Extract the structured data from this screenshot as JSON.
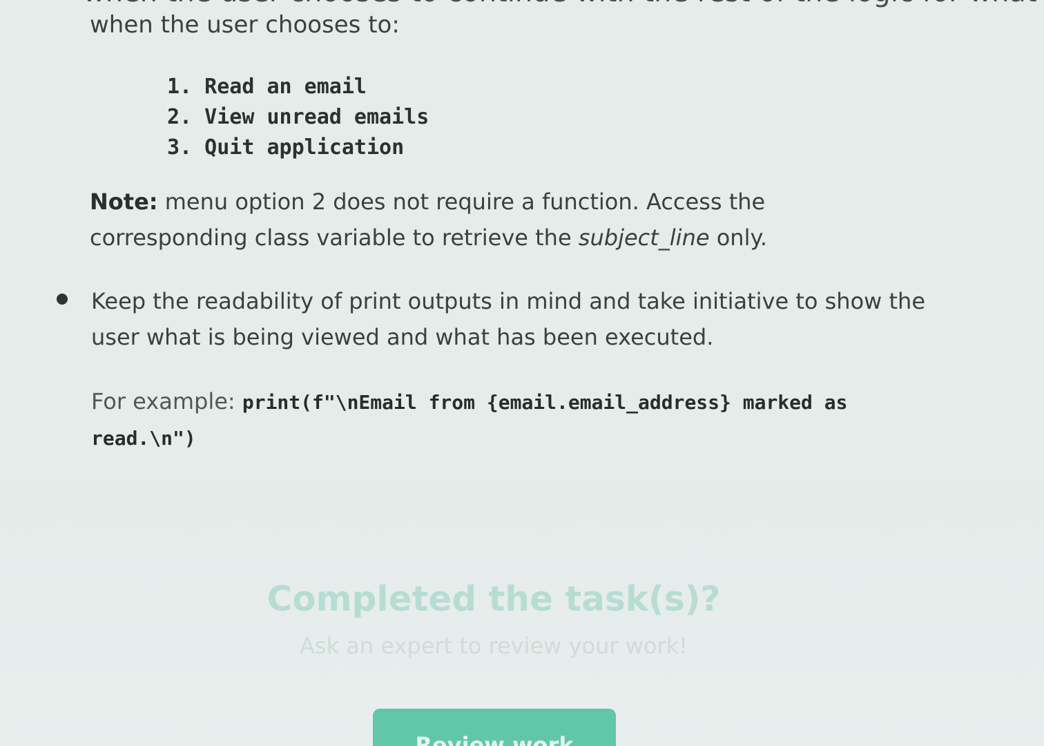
{
  "content": {
    "top_line_partial": "when the user chooses to continue with the rest of the logic for what should happen",
    "intro": "when the user chooses to:",
    "menu_items": [
      "1. Read an email",
      "2. View unread emails",
      "3. Quit application"
    ],
    "note": {
      "label": "Note:",
      "text_before": " menu option 2 does not require a function. Access the corresponding class variable to retrieve the ",
      "emphasis": "subject_line",
      "text_after": " only."
    },
    "bullet": "Keep the readability of print outputs in mind and take initiative to show the user what is being viewed and what has been executed.",
    "example": {
      "label": "For example: ",
      "code": "print(f\"\\nEmail from {email.email_address} marked as read.\\n\")"
    }
  },
  "review_section": {
    "title": "Completed the task(s)?",
    "subtitle": "Ask an expert to review your work!",
    "button_label": "Review work"
  },
  "colors": {
    "accent": "#62c6a9",
    "background": "#e6ecea",
    "text": "#364240"
  }
}
